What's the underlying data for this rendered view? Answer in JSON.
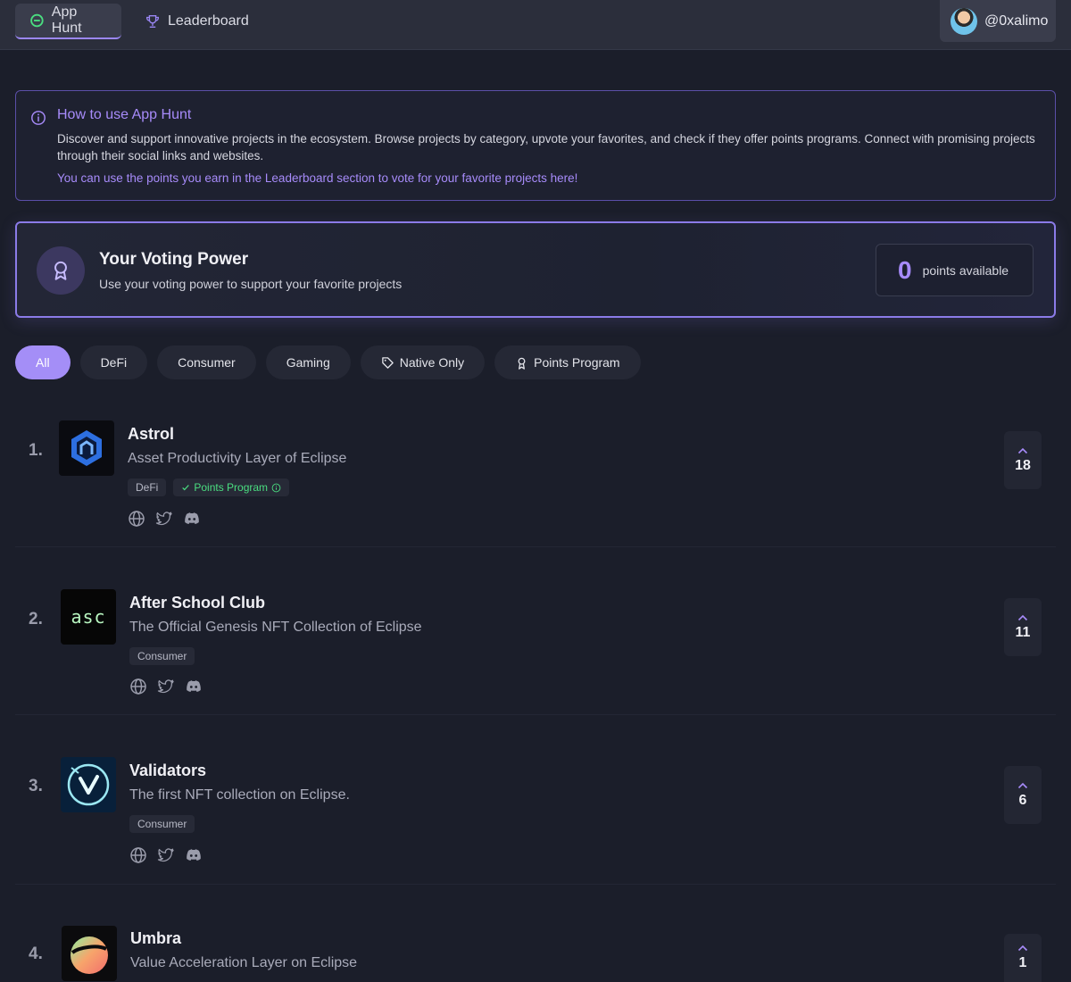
{
  "nav": {
    "tabs": [
      {
        "label": "App Hunt",
        "icon": "eclipse-logo-icon"
      },
      {
        "label": "Leaderboard",
        "icon": "trophy-icon"
      }
    ],
    "user": "@0xalimo"
  },
  "info": {
    "title": "How to use App Hunt",
    "body": "Discover and support innovative projects in the ecosystem. Browse projects by category, upvote your favorites, and check if they offer points programs. Connect with promising projects through their social links and websites.",
    "note": "You can use the points you earn in the Leaderboard section to vote for your favorite projects here!"
  },
  "voting": {
    "title": "Your Voting Power",
    "subtitle": "Use your voting power to support your favorite projects",
    "points": "0",
    "points_label": "points available"
  },
  "filters": [
    {
      "label": "All",
      "active": true
    },
    {
      "label": "DeFi"
    },
    {
      "label": "Consumer"
    },
    {
      "label": "Gaming"
    },
    {
      "label": "Native Only",
      "icon": "tag-icon"
    },
    {
      "label": "Points Program",
      "icon": "award-icon"
    }
  ],
  "apps": [
    {
      "rank": "1.",
      "name": "Astrol",
      "description": "Asset Productivity Layer of Eclipse",
      "tags": [
        "DeFi"
      ],
      "points_program": "Points Program",
      "votes": "18"
    },
    {
      "rank": "2.",
      "name": "After School Club",
      "description": "The Official Genesis NFT Collection of Eclipse",
      "tags": [
        "Consumer"
      ],
      "votes": "11"
    },
    {
      "rank": "3.",
      "name": "Validators",
      "description": "The first NFT collection on Eclipse.",
      "tags": [
        "Consumer"
      ],
      "votes": "6"
    },
    {
      "rank": "4.",
      "name": "Umbra",
      "description": "Value Acceleration Layer on Eclipse",
      "tags": [],
      "votes": "1"
    }
  ],
  "logo_text": {
    "asc": "asc"
  },
  "colors": {
    "accent": "#a78bfa",
    "background": "#1b1e2a",
    "green": "#4ade80"
  }
}
